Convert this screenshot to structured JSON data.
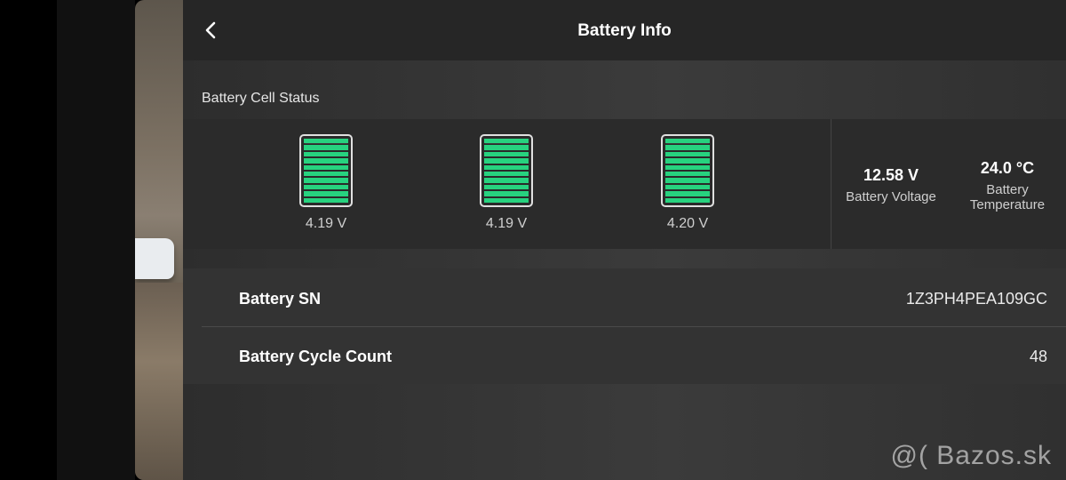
{
  "header": {
    "title": "Battery Info"
  },
  "section": {
    "cell_status_title": "Battery Cell Status"
  },
  "cells": [
    {
      "voltage": "4.19 V",
      "level": 1.0
    },
    {
      "voltage": "4.19 V",
      "level": 1.0
    },
    {
      "voltage": "4.20 V",
      "level": 1.0
    }
  ],
  "stats": {
    "voltage_value": "12.58 V",
    "voltage_label": "Battery Voltage",
    "temperature_value": "24.0 °C",
    "temperature_label_line1": "Battery",
    "temperature_label_line2": "Temperature"
  },
  "details": {
    "sn_label": "Battery SN",
    "sn_value": "1Z3PH4PEA109GC",
    "cycle_label": "Battery Cycle Count",
    "cycle_value": "48"
  },
  "watermark": "@( Bazos.sk",
  "colors": {
    "cell_fill": "#27d27f",
    "header_bg": "#262626",
    "panel_bg": "#2b2b2b"
  },
  "icons": {
    "back": "chevron-left-icon",
    "cell": "battery-cell-icon"
  }
}
